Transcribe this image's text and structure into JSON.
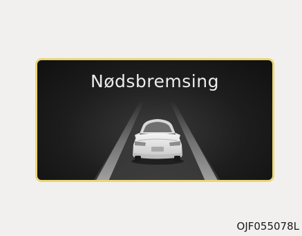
{
  "display": {
    "title": "Nødsbremsing",
    "border_color": "#e9d777",
    "background_color": "#1d1d1d",
    "icon": "car-rear-icon"
  },
  "figure": {
    "code": "OJF055078L"
  }
}
